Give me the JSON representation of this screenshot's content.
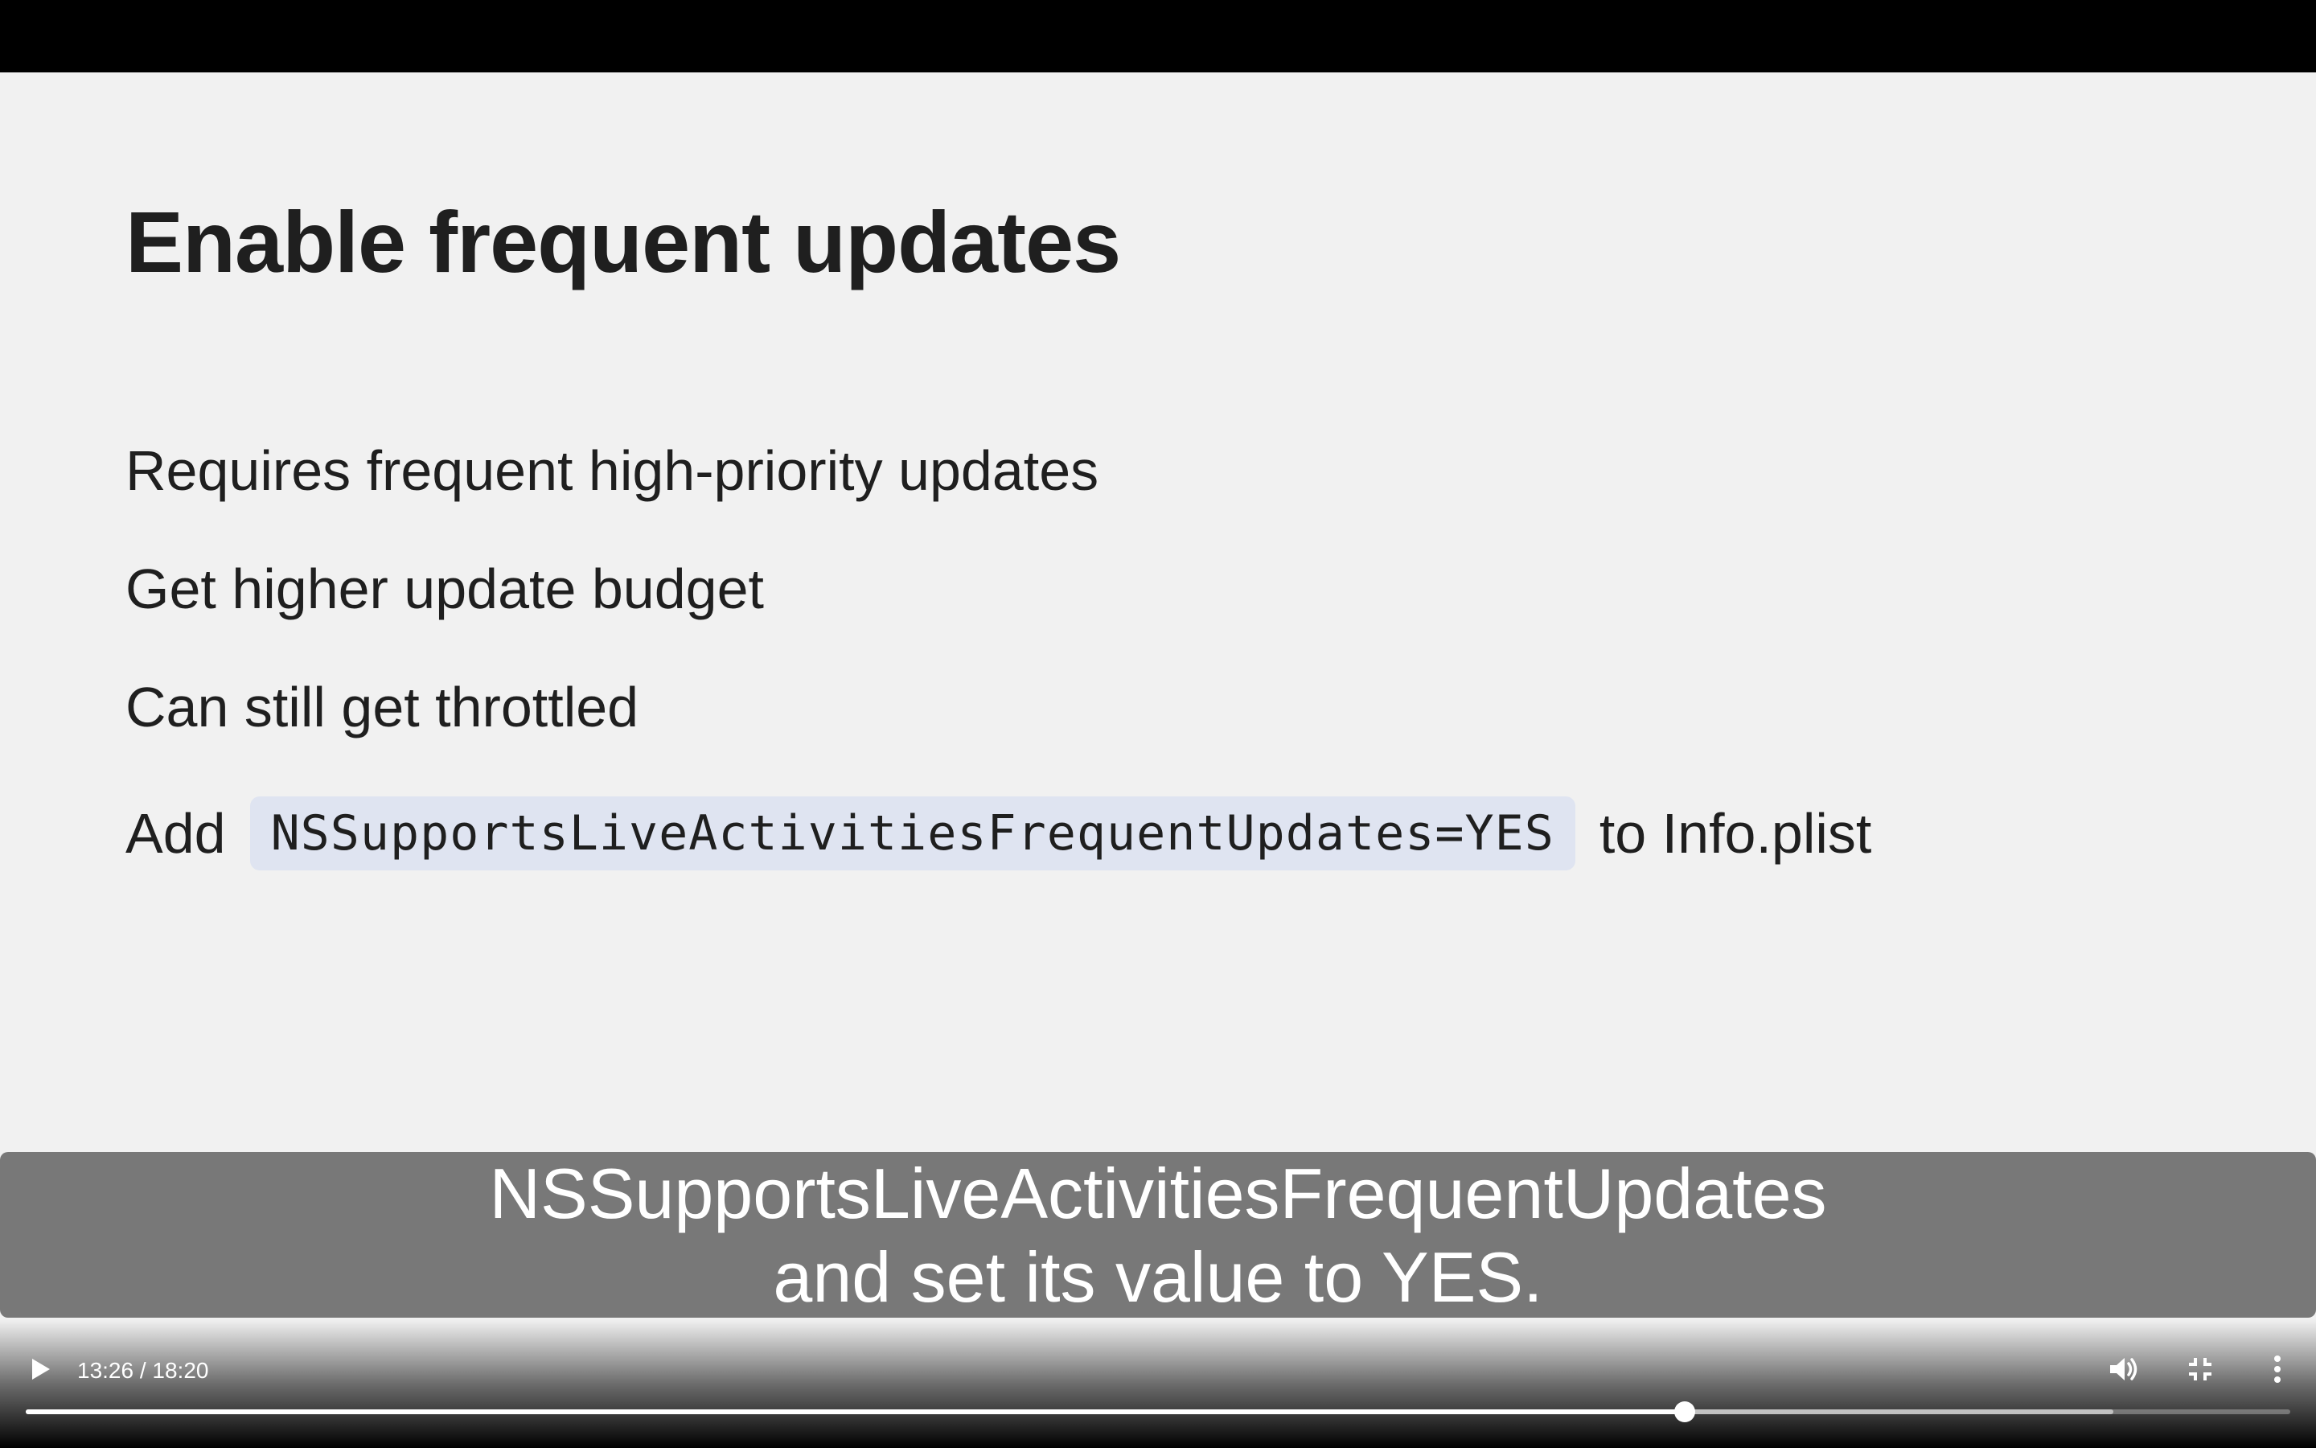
{
  "slide": {
    "title": "Enable frequent updates",
    "bullets": [
      "Requires frequent high-priority updates",
      "Get higher update budget",
      "Can still get throttled"
    ],
    "last_bullet": {
      "prefix": "Add",
      "code": "NSSupportsLiveActivitiesFrequentUpdates=YES",
      "suffix": "to Info.plist"
    }
  },
  "caption": {
    "line1": "NSSupportsLiveActivitiesFrequentUpdates",
    "line2": "and set its value to YES."
  },
  "player": {
    "time": "13:26 / 18:20",
    "played_fraction": 0.7327,
    "buffered_fraction": 0.922,
    "icons": {
      "play": "play-icon",
      "volume": "volume-icon",
      "fullscreen": "exit-fullscreen-icon",
      "more": "more-vertical-icon"
    }
  }
}
